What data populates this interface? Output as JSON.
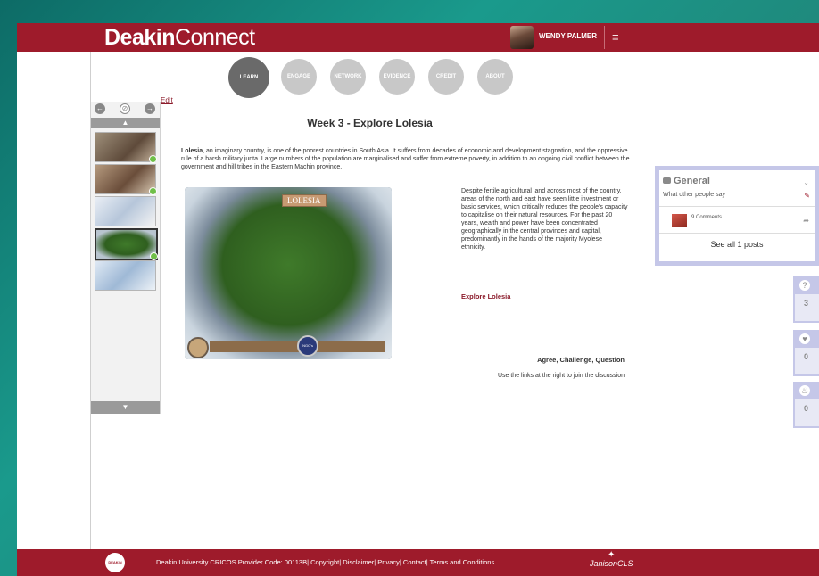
{
  "header": {
    "brand_bold": "Deakin",
    "brand_light": "Connect",
    "user_name": "WENDY PALMER",
    "menu_icon": "hamburger-icon"
  },
  "nav": {
    "tabs": [
      {
        "label": "LEARN",
        "active": true
      },
      {
        "label": "ENGAGE",
        "active": false
      },
      {
        "label": "NETWORK",
        "active": false
      },
      {
        "label": "EVIDENCE",
        "active": false
      },
      {
        "label": "CREDIT",
        "active": false
      },
      {
        "label": "ABOUT",
        "active": false
      }
    ]
  },
  "filmstrip": {
    "controls": {
      "prev_icon": "arrow-left-icon",
      "compass_icon": "compass-icon",
      "next_icon": "arrow-right-icon"
    },
    "edit_label": "Edit",
    "thumbnails": [
      {
        "completed": true
      },
      {
        "completed": true
      },
      {
        "completed": false
      },
      {
        "completed": true,
        "current": true
      },
      {
        "completed": false
      }
    ]
  },
  "content": {
    "title": "Week 3 - Explore Lolesia",
    "intro_bold": "Lolesia",
    "intro_rest": ", an imaginary country, is one of the poorest countries in South Asia. It suffers from decades of economic and development stagnation, and the oppressive rule of a harsh military junta. Large numbers of the population are marginalised and suffer from extreme poverty, in addition to an ongoing civil conflict between the government and hill tribes in the Eastern Machin province.",
    "map_title": "LOLESIA",
    "map_ngo": "NGO's",
    "side_text": "Despite fertile agricultural land across most of the country, areas of the north and east have seen little investment or basic services, which critically reduces the people's capacity to capitalise on their natural resources. For the past 20 years, wealth and power have been concentrated geographically in the central provinces and capital, predominantly in the hands of the majority Myolese ethnicity.",
    "explore_link": "Explore Lolesia",
    "agree_heading": "Agree, Challenge, Question",
    "use_links_text": "Use the links at the right to join the discussion"
  },
  "general_panel": {
    "title": "General",
    "subtitle": "What other people say",
    "comments": "9 Comments",
    "see_all": "See all 1 posts"
  },
  "stats": [
    {
      "icon": "question-icon",
      "value": "3"
    },
    {
      "icon": "heart-icon",
      "value": "0"
    },
    {
      "icon": "flame-icon",
      "value": "0"
    }
  ],
  "footer": {
    "text": "Deakin University CRICOS Provider Code: 00113B| Copyright| Disclaimer| Privacy| Contact| Terms and Conditions",
    "brand": "JanisonCLS",
    "logo_text": "DEAKIN"
  },
  "colors": {
    "brand": "#9e1b2b",
    "panel_border": "#c5c7e8",
    "nav_active": "#6a6a6a",
    "nav_inactive": "#c8c8c8"
  }
}
